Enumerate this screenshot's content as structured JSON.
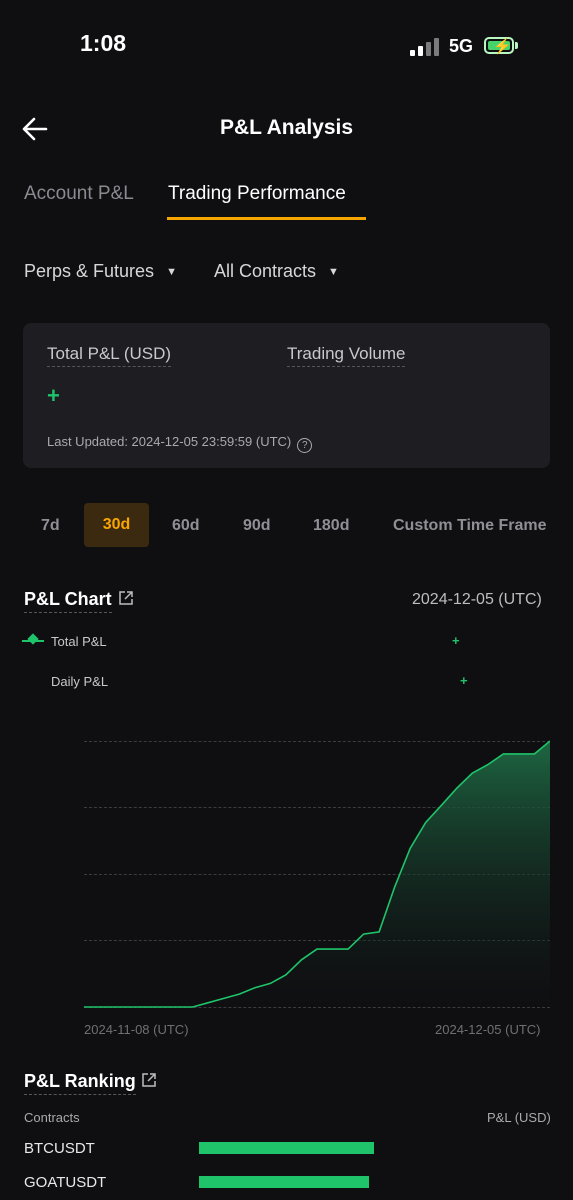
{
  "status_bar": {
    "time": "1:08",
    "network": "5G"
  },
  "header": {
    "title": "P&L Analysis"
  },
  "tabs": [
    {
      "label": "Account P&L",
      "active": false
    },
    {
      "label": "Trading Performance",
      "active": true
    }
  ],
  "filters": {
    "product": "Perps & Futures",
    "contracts": "All Contracts"
  },
  "summary": {
    "total_pnl_label": "Total P&L (USD)",
    "trading_volume_label": "Trading Volume",
    "pnl_sign": "+",
    "last_updated": "Last Updated: 2024-12-05 23:59:59 (UTC)"
  },
  "time_ranges": [
    {
      "label": "7d",
      "active": false
    },
    {
      "label": "30d",
      "active": true
    },
    {
      "label": "60d",
      "active": false
    },
    {
      "label": "90d",
      "active": false
    },
    {
      "label": "180d",
      "active": false
    },
    {
      "label": "Custom Time Frame",
      "active": false
    }
  ],
  "pnl_chart": {
    "title": "P&L Chart",
    "date": "2024-12-05 (UTC)",
    "legend_total": "Total P&L",
    "legend_daily": "Daily P&L",
    "legend_total_sign": "+",
    "legend_daily_sign": "+",
    "x_start_label": "2024-11-08 (UTC)",
    "x_end_label": "2024-12-05 (UTC)"
  },
  "chart_data": {
    "type": "area",
    "series": [
      {
        "values": [
          0,
          0,
          0,
          0,
          0,
          0,
          0,
          0,
          0.02,
          0.04,
          0.06,
          0.09,
          0.11,
          0.15,
          0.22,
          0.27,
          0.27,
          0.27,
          0.34,
          0.35,
          0.56,
          0.74,
          0.86,
          0.94,
          1.02,
          1.09,
          1.13,
          1.18,
          1.18,
          1.18,
          1.24
        ]
      }
    ],
    "x_start": "2024-11-08",
    "x_end": "2024-12-05",
    "grid": true,
    "colors": {
      "line": "#1fc46a",
      "fill_top": "#1e6b44",
      "fill_bottom": "#0f0f12"
    }
  },
  "ranking": {
    "title": "P&L Ranking",
    "col_contracts": "Contracts",
    "col_pnl": "P&L (USD)",
    "rows": [
      {
        "name": "BTCUSDT",
        "share": 1.0
      },
      {
        "name": "GOATUSDT",
        "share": 0.97
      }
    ]
  },
  "colors": {
    "accent": "#f7a600",
    "profit": "#1fc46a",
    "background": "#0f0f12",
    "card": "#1d1d22"
  }
}
